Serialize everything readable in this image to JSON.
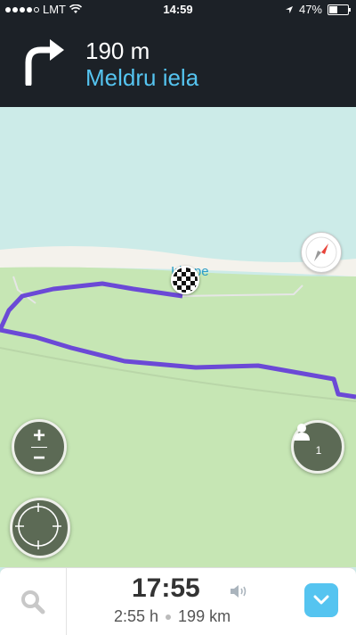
{
  "status_bar": {
    "carrier": "LMT",
    "time": "14:59",
    "battery": "47%",
    "battery_level": 0.47
  },
  "instruction": {
    "distance": "190 m",
    "street": "Meldru iela",
    "turn_icon": "turn-right-icon"
  },
  "map": {
    "place_label": "Irbupe",
    "destination_icon": "checkered-flag-icon"
  },
  "controls": {
    "zoom_in_label": "+",
    "zoom_out_label": "−",
    "users_count": "1"
  },
  "trip": {
    "arrival_time": "17:55",
    "duration": "2:55 h",
    "distance": "199 km"
  },
  "colors": {
    "header_bg": "#1c2127",
    "street_text": "#55c4f0",
    "route": "#6b49d6",
    "land": "#c6e6b4",
    "water": "#ccebe8",
    "accent": "#55c4f0"
  }
}
